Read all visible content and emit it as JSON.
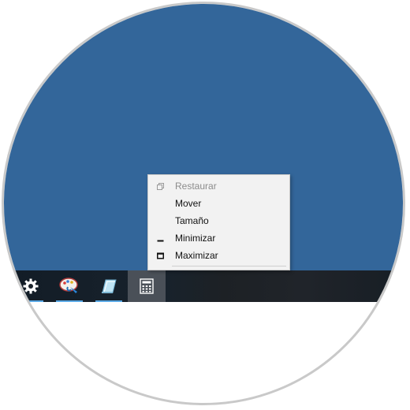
{
  "colors": {
    "desktop_background": "#33669a",
    "taskbar_background": "#1a222b",
    "taskbar_active_item": "#4a5058",
    "taskbar_underline": "#5aa9e6",
    "menu_background": "#f2f2f2"
  },
  "taskbar": {
    "items": [
      {
        "name": "settings",
        "icon": "gear-icon",
        "running": true
      },
      {
        "name": "paint",
        "icon": "paint-palette-icon",
        "running": true
      },
      {
        "name": "notepad",
        "icon": "notepad-icon",
        "running": true
      },
      {
        "name": "calculator",
        "icon": "calculator-icon",
        "active": true
      }
    ]
  },
  "context_menu": {
    "items": [
      {
        "label": "Restaurar",
        "icon": "restore-icon",
        "enabled": false
      },
      {
        "label": "Mover",
        "icon": "",
        "enabled": true
      },
      {
        "label": "Tamaño",
        "icon": "",
        "enabled": true
      },
      {
        "label": "Minimizar",
        "icon": "minimize-icon",
        "enabled": true
      },
      {
        "label": "Maximizar",
        "icon": "maximize-icon",
        "enabled": true
      }
    ]
  }
}
